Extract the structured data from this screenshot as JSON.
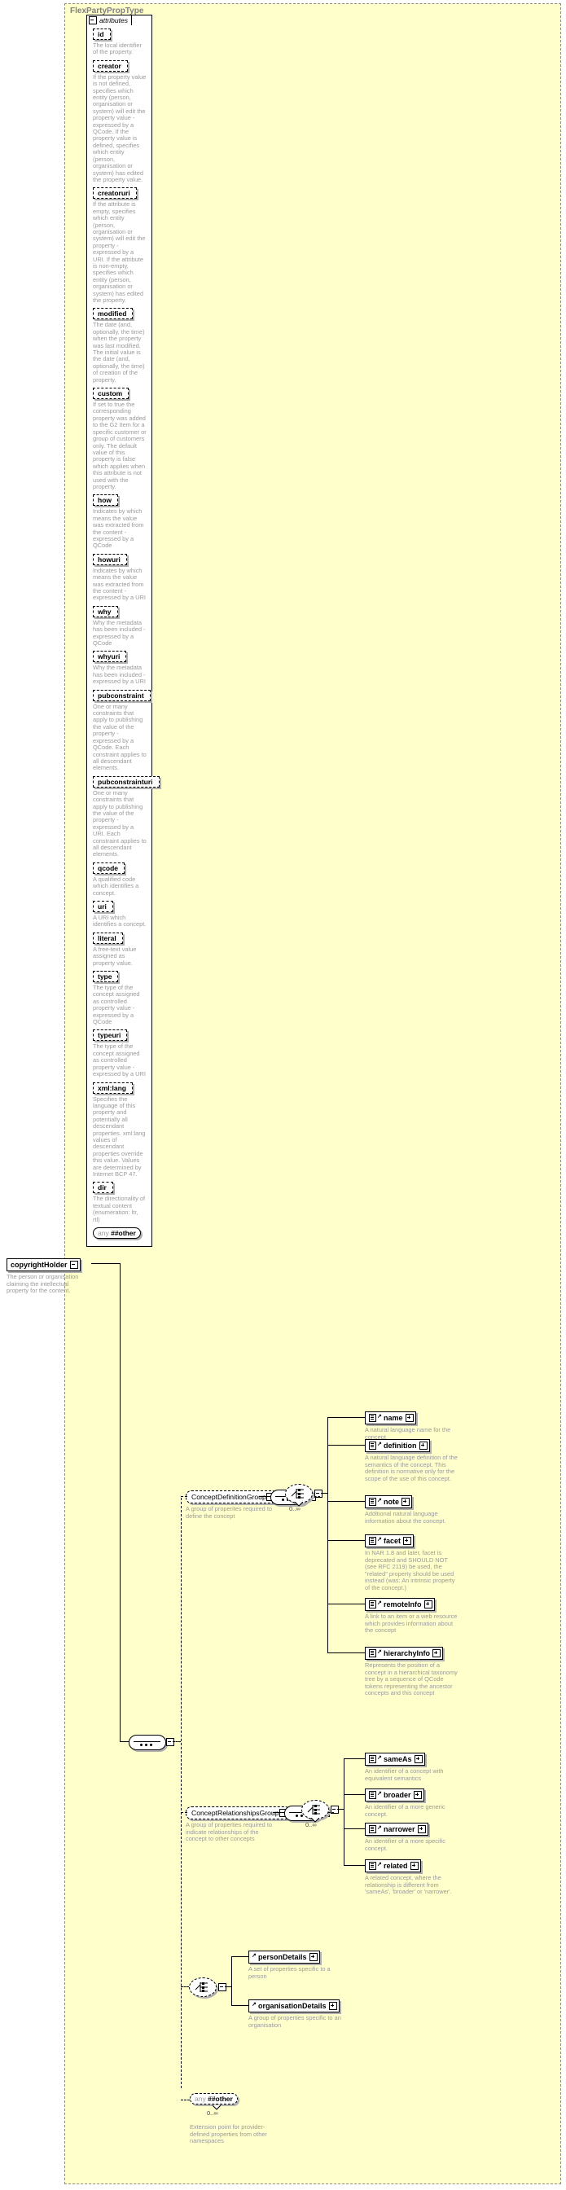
{
  "diagram": {
    "type_name": "FlexPartyPropType",
    "attributes_tab": "attributes",
    "attributes": [
      {
        "name": "id",
        "desc": "The local identifier of the property."
      },
      {
        "name": "creator",
        "desc": "If the property value is not defined, specifies which entity (person, organisation or system) will edit the property value - expressed by a QCode. If the property value is defined, specifies which entity (person, organisation or system) has edited the property value."
      },
      {
        "name": "creatoruri",
        "desc": "If the attribute is empty, specifies which entity (person, organisation or system) will edit the property - expressed by a URI. If the attribute is non-empty, specifies which entity (person, organisation or system) has edited the property."
      },
      {
        "name": "modified",
        "desc": "The date (and, optionally, the time) when the property was last modified. The initial value is the date (and, optionally, the time) of creation of the property."
      },
      {
        "name": "custom",
        "desc": "If set to true the corresponding property was added to the G2 Item for a specific customer or group of customers only. The default value of this property is false which applies when this attribute is not used with the property."
      },
      {
        "name": "how",
        "desc": "Indicates by which means the value was extracted from the content - expressed by a QCode"
      },
      {
        "name": "howuri",
        "desc": "Indicates by which means the value was extracted from the content - expressed by a URI"
      },
      {
        "name": "why",
        "desc": "Why the metadata has been included - expressed by a QCode"
      },
      {
        "name": "whyuri",
        "desc": "Why the metadata has been included - expressed by a URI"
      },
      {
        "name": "pubconstraint",
        "desc": "One or many constraints that apply to publishing the value of the property - expressed by a QCode. Each constraint applies to all descendant elements."
      },
      {
        "name": "pubconstrainturi",
        "desc": "One or many constraints that apply to publishing the value of the property - expressed by a URI. Each constraint applies to all descendant elements."
      },
      {
        "name": "qcode",
        "desc": "A qualified code which identifies a concept."
      },
      {
        "name": "uri",
        "desc": "A URI which identifies a concept."
      },
      {
        "name": "literal",
        "desc": "A free-text value assigned as property value."
      },
      {
        "name": "type",
        "desc": "The type of the concept assigned as controlled property value - expressed by a QCode"
      },
      {
        "name": "typeuri",
        "desc": "The type of the concept assigned as controlled property value - expressed by a URI"
      },
      {
        "name": "xml:lang",
        "desc": "Specifies the language of this property and potentially all descendant properties. xml:lang values of descendant properties override this value. Values are determined by Internet BCP 47."
      },
      {
        "name": "dir",
        "desc": "The directionality of textual content (enumeration: ltr, rtl)"
      }
    ],
    "attributes_any": {
      "any_label": "any",
      "other_label": "##other"
    },
    "root_element": {
      "name": "copyrightHolder",
      "desc": "The person or organisation claiming the intellectual property for the content."
    },
    "groups": [
      {
        "name": "ConceptDefinitionGroup",
        "desc": "A group of properites required to define the concept",
        "occurs": "0..∞",
        "children": [
          {
            "name": "name",
            "desc": "A natural language name for the concept."
          },
          {
            "name": "definition",
            "desc": "A natural language definition of the semantics of the concept. This definition is normative only for the scope of the use of this concept."
          },
          {
            "name": "note",
            "desc": "Additional natural language information about the concept."
          },
          {
            "name": "facet",
            "desc": "In NAR 1.8 and later, facet is deprecated and SHOULD NOT (see RFC 2119) be used, the \"related\" property should be used instead (was: An intrinsic property of the concept.)"
          },
          {
            "name": "remoteInfo",
            "desc": "A link to an item or a web resource which provides information about the concept"
          },
          {
            "name": "hierarchyInfo",
            "desc": "Represents the position of a concept in a hierarchical taxonomy tree by a sequence of QCode tokens representing the ancestor concepts and this concept"
          }
        ]
      },
      {
        "name": "ConceptRelationshipsGroup",
        "desc": "A group of properties required to indicate relationships of the concept to other concepts",
        "occurs": "0..∞",
        "children": [
          {
            "name": "sameAs",
            "desc": "An identifier of a concept with equivalent semantics"
          },
          {
            "name": "broader",
            "desc": "An identifier of a more generic concept."
          },
          {
            "name": "narrower",
            "desc": "An identifier of a more specific concept."
          },
          {
            "name": "related",
            "desc": "A related concept, where the relationship is different from 'sameAs', 'broader' or 'narrower'."
          }
        ]
      }
    ],
    "details_choice": {
      "children": [
        {
          "name": "personDetails",
          "desc": "A set of properties specific to a person"
        },
        {
          "name": "organisationDetails",
          "desc": "A group of properties specific to an organisation"
        }
      ]
    },
    "body_any": {
      "any_label": "any",
      "other_label": "##other",
      "occurs": "0..∞",
      "desc": "Extension point for provider-defined properties from other namespaces"
    },
    "colors": {
      "frame_background": "#ffffcc",
      "frame_border": "#8c8c8c",
      "title_color": "#808080",
      "description_color": "#9a9a9a",
      "shadow": "#b0b0b0"
    }
  }
}
